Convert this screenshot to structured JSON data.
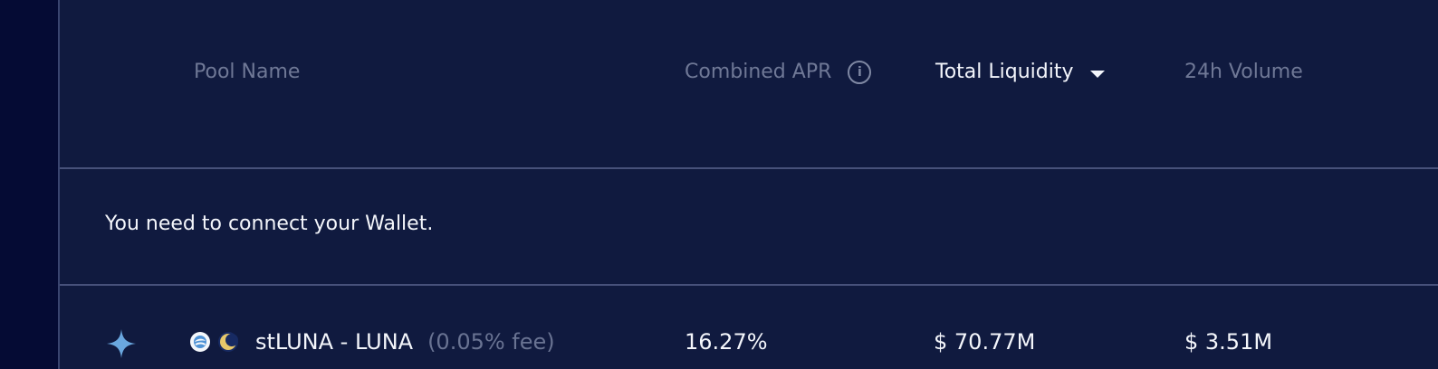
{
  "table": {
    "columns": {
      "pool_name": "Pool Name",
      "combined_apr": "Combined APR",
      "total_liquidity": "Total Liquidity",
      "volume_24h": "24h Volume"
    },
    "notice": "You need to connect your Wallet.",
    "rows": [
      {
        "pair": "stLUNA - LUNA",
        "fee": "(0.05% fee)",
        "combined_apr": "16.27%",
        "total_liquidity": "$ 70.77M",
        "volume_24h": "$ 3.51M"
      }
    ]
  },
  "icons": {
    "info": "info-icon",
    "sort": "chevron-down-icon",
    "featured": "star-icon",
    "token_1": "stluna-token-icon",
    "token_2": "luna-token-icon"
  },
  "colors": {
    "background": "#101a3f",
    "left_rail": "#050b34",
    "divider": "#47517a",
    "muted_text": "#6f7896",
    "primary_text": "#f4f6fb",
    "star": "#6aa7df",
    "luna_yellow": "#e7c86a"
  }
}
